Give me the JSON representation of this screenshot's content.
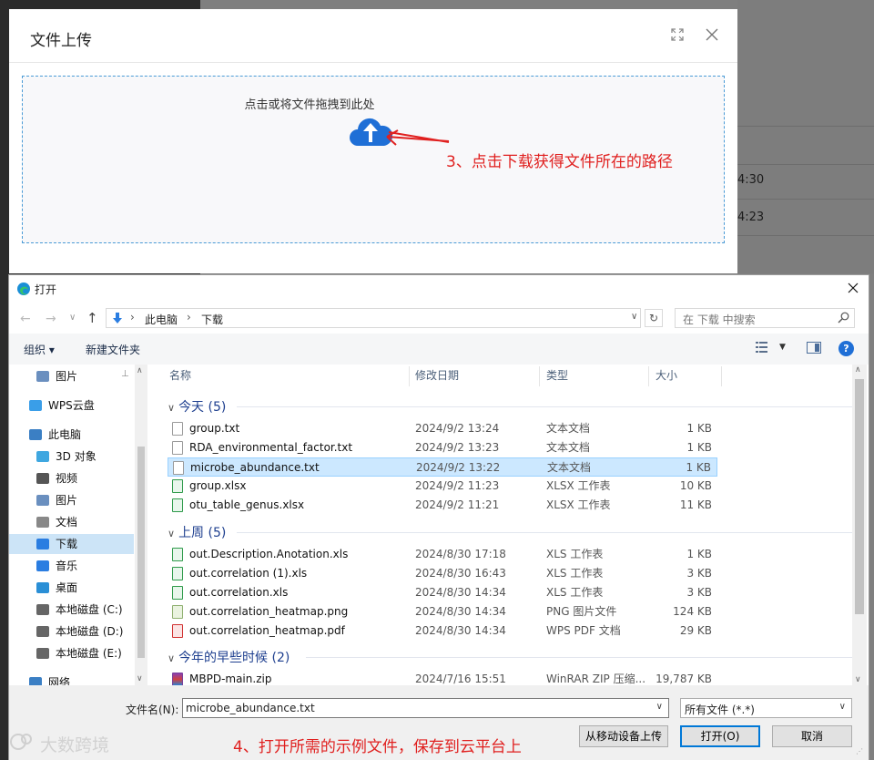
{
  "background": {
    "times": [
      "4:30",
      "4:23"
    ]
  },
  "upload_modal": {
    "title": "文件上传",
    "drop_hint": "点击或将文件拖拽到此处",
    "annotation": "3、点击下载获得文件所在的路径"
  },
  "open_dialog": {
    "title": "打开",
    "breadcrumb": [
      "此电脑",
      "下载"
    ],
    "search_placeholder": "在 下载 中搜索",
    "toolbar": {
      "organize": "组织 ▾",
      "new_folder": "新建文件夹"
    },
    "nav_items": [
      {
        "label": "图片",
        "icon": "pictures-icon"
      },
      {
        "label": "WPS云盘",
        "icon": "cloud-icon"
      },
      {
        "label": "此电脑",
        "icon": "computer-icon"
      },
      {
        "label": "3D 对象",
        "icon": "3d-objects-icon"
      },
      {
        "label": "视频",
        "icon": "video-icon"
      },
      {
        "label": "图片",
        "icon": "pictures-icon"
      },
      {
        "label": "文档",
        "icon": "documents-icon"
      },
      {
        "label": "下载",
        "icon": "download-icon",
        "selected": true
      },
      {
        "label": "音乐",
        "icon": "music-icon"
      },
      {
        "label": "桌面",
        "icon": "desktop-icon"
      },
      {
        "label": "本地磁盘 (C:)",
        "icon": "drive-icon"
      },
      {
        "label": "本地磁盘 (D:)",
        "icon": "drive-icon"
      },
      {
        "label": "本地磁盘 (E:)",
        "icon": "drive-icon"
      },
      {
        "label": "网络",
        "icon": "network-icon"
      }
    ],
    "columns": [
      "名称",
      "修改日期",
      "类型",
      "大小"
    ],
    "groups": [
      {
        "label": "今天 (5)",
        "files": [
          {
            "name": "group.txt",
            "date": "2024/9/2 13:24",
            "type": "文本文档",
            "size": "1 KB",
            "icon": "text-file-icon"
          },
          {
            "name": "RDA_environmental_factor.txt",
            "date": "2024/9/2 13:23",
            "type": "文本文档",
            "size": "1 KB",
            "icon": "text-file-icon"
          },
          {
            "name": "microbe_abundance.txt",
            "date": "2024/9/2 13:22",
            "type": "文本文档",
            "size": "1 KB",
            "icon": "text-file-icon",
            "selected": true
          },
          {
            "name": "group.xlsx",
            "date": "2024/9/2 11:23",
            "type": "XLSX 工作表",
            "size": "10 KB",
            "icon": "spreadsheet-icon"
          },
          {
            "name": "otu_table_genus.xlsx",
            "date": "2024/9/2 11:21",
            "type": "XLSX 工作表",
            "size": "11 KB",
            "icon": "spreadsheet-icon"
          }
        ]
      },
      {
        "label": "上周 (5)",
        "files": [
          {
            "name": "out.Description.Anotation.xls",
            "date": "2024/8/30 17:18",
            "type": "XLS 工作表",
            "size": "1 KB",
            "icon": "spreadsheet-icon"
          },
          {
            "name": "out.correlation (1).xls",
            "date": "2024/8/30 16:43",
            "type": "XLS 工作表",
            "size": "3 KB",
            "icon": "spreadsheet-icon"
          },
          {
            "name": "out.correlation.xls",
            "date": "2024/8/30 14:34",
            "type": "XLS 工作表",
            "size": "3 KB",
            "icon": "spreadsheet-icon"
          },
          {
            "name": "out.correlation_heatmap.png",
            "date": "2024/8/30 14:34",
            "type": "PNG 图片文件",
            "size": "124 KB",
            "icon": "png-file-icon"
          },
          {
            "name": "out.correlation_heatmap.pdf",
            "date": "2024/8/30 14:34",
            "type": "WPS PDF 文档",
            "size": "29 KB",
            "icon": "pdf-file-icon"
          }
        ]
      },
      {
        "label": "今年的早些时候 (2)",
        "files": [
          {
            "name": "MBPD-main.zip",
            "date": "2024/7/16 15:51",
            "type": "WinRAR ZIP 压缩...",
            "size": "19,787 KB",
            "icon": "zip-file-icon"
          }
        ]
      }
    ],
    "filename_label": "文件名(N):",
    "filename_value": "microbe_abundance.txt",
    "filetype_value": "所有文件 (*.*)",
    "buttons": {
      "upload_from_device": "从移动设备上传",
      "open": "打开(O)",
      "cancel": "取消"
    },
    "annotation": "4、打开所需的示例文件，保存到云平台上"
  },
  "watermark": "大数跨境",
  "colors": {
    "annotation": "#e0201f",
    "accent": "#1f6fd6",
    "selection": "#cce8ff"
  }
}
